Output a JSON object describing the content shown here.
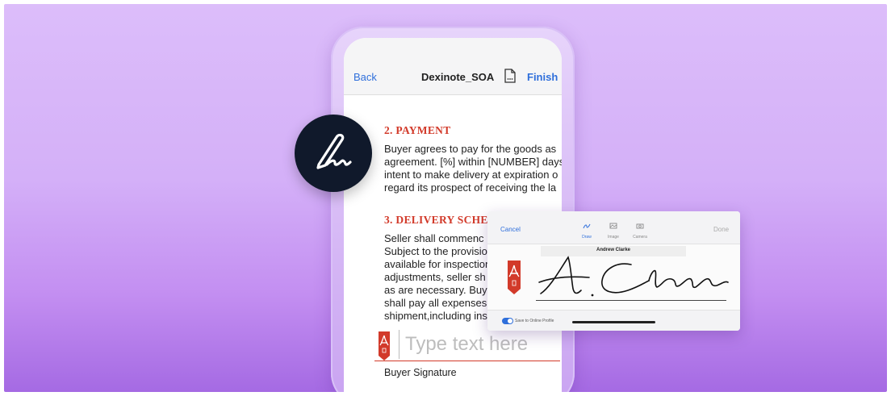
{
  "nav": {
    "back_label": "Back",
    "title": "Dexinote_SOA",
    "doc_icon": "document-more-icon",
    "finish_label": "Finish"
  },
  "document": {
    "section1": {
      "heading": "2. PAYMENT",
      "lines": [
        "Buyer agrees to pay for the goods as",
        "agreement. [%] within [NUMBER] days",
        "intent to make delivery at expiration o",
        "regard its prospect of receiving the la"
      ]
    },
    "section2": {
      "heading": "3. DELIVERY SCHE",
      "lines": [
        "Seller shall commenc",
        "Subject to the provisio",
        "available for inspection",
        "adjustments, seller sh",
        "as are necessary. Buy",
        "shall pay all expenses",
        "shipment,including ins"
      ]
    },
    "signature_field": {
      "placeholder": "Type text here",
      "flag_icon": "acrobat-sign-flag-icon",
      "label": "Buyer Signature"
    }
  },
  "badge": {
    "icon": "signature-pen-icon",
    "background": "#10192b"
  },
  "signature_card": {
    "cancel_label": "Cancel",
    "done_label": "Done",
    "modes": [
      {
        "label": "Draw",
        "icon": "draw-icon",
        "active": true
      },
      {
        "label": "Image",
        "icon": "image-icon",
        "active": false
      },
      {
        "label": "Camera",
        "icon": "camera-icon",
        "active": false
      }
    ],
    "signer_name": "Andrew Clarke",
    "flag_icon": "acrobat-sign-flag-icon",
    "save_toggle_label": "Save to Online Profile",
    "save_toggle_on": true
  },
  "colors": {
    "accent_red": "#d23a2a",
    "link_blue": "#2f6fdb",
    "background_purple": "#c38ef1"
  }
}
